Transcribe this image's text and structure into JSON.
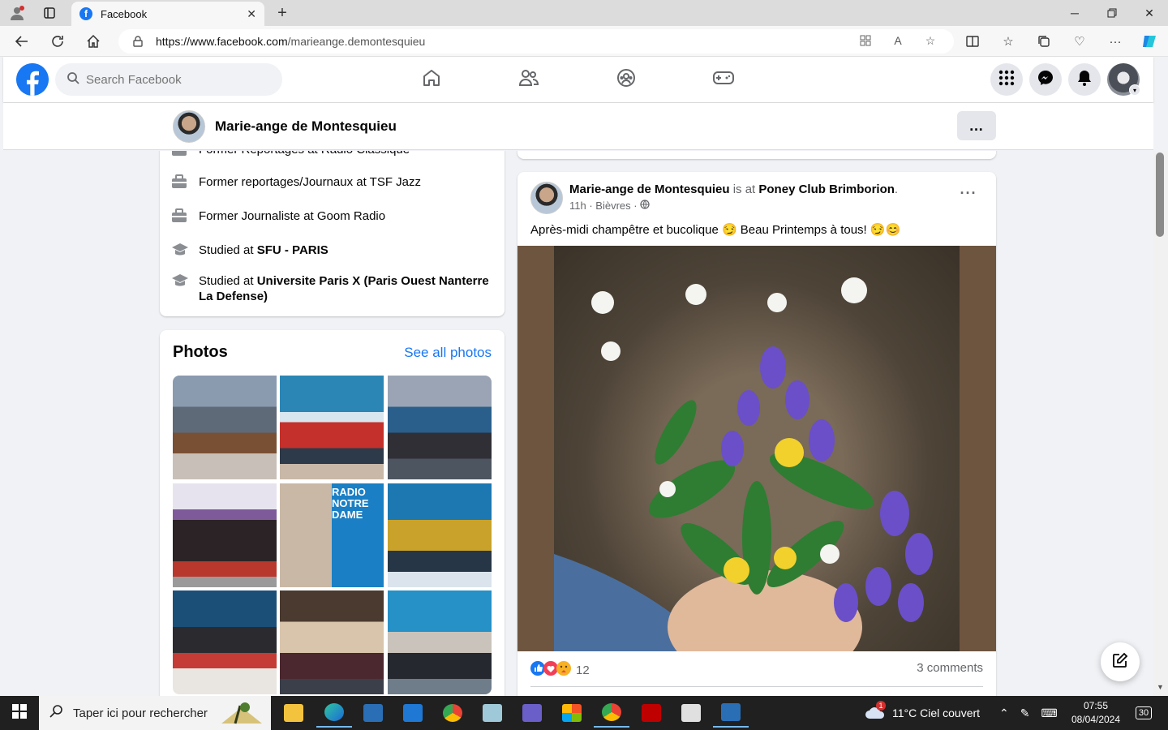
{
  "browser": {
    "tab_title": "Facebook",
    "url_domain": "https://www.facebook.com",
    "url_path": "/marieange.demontesquieu"
  },
  "fb": {
    "search_placeholder": "Search Facebook"
  },
  "profile": {
    "name": "Marie-ange de Montesquieu",
    "more_label": "…"
  },
  "intro": {
    "items": [
      {
        "text": "Former Reportages at Radio Classique",
        "bold": ""
      },
      {
        "text": "Former reportages/Journaux at TSF Jazz",
        "bold": ""
      },
      {
        "text": "Former Journaliste at Goom Radio",
        "bold": ""
      },
      {
        "text": "Studied at ",
        "bold": "SFU - PARIS"
      },
      {
        "text": "Studied at ",
        "bold": "Universite Paris X (Paris Ouest Nanterre La Defense)"
      }
    ]
  },
  "photos": {
    "title": "Photos",
    "see_all": "See all photos",
    "radio_logo_text": "RADIO NOTRE DAME"
  },
  "post": {
    "author": "Marie-ange de Montesquieu",
    "is_at": " is at ",
    "place": "Poney Club Brimborion",
    "time": "11h",
    "location": "Bièvres",
    "message": "Après-midi champêtre et bucolique 😏 Beau Printemps à tous! 😏😊",
    "reaction_count": "12",
    "comments": "3 comments"
  },
  "taskbar": {
    "search_placeholder": "Taper ici pour rechercher",
    "weather_badge": "1",
    "weather": "11°C  Ciel couvert",
    "time": "07:55",
    "date": "08/04/2024",
    "notifications": "30"
  }
}
